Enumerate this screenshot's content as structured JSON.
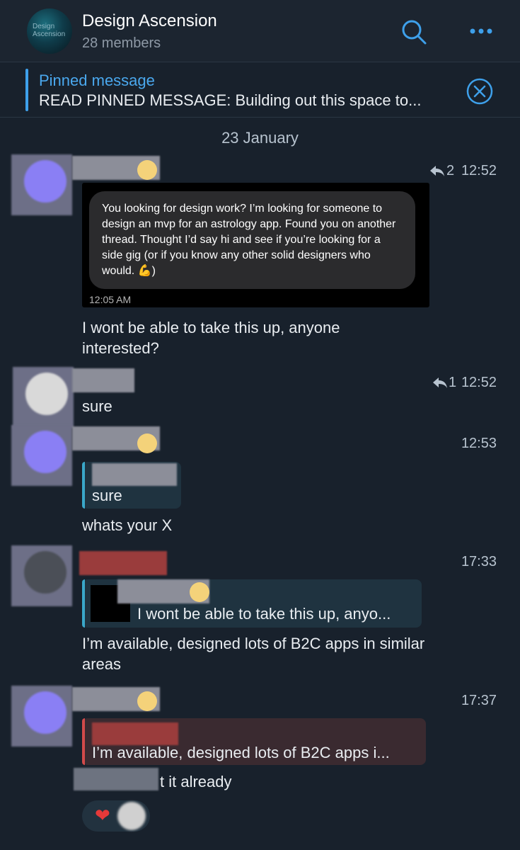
{
  "header": {
    "group_avatar_text_line1": "Design",
    "group_avatar_text_line2": "Ascension",
    "title": "Design Ascension",
    "subtitle": "28 members",
    "search_icon": "search-icon",
    "more_icon": "more-horizontal-icon"
  },
  "pinned": {
    "title": "Pinned message",
    "text": "READ PINNED MESSAGE:  Building out this space to...",
    "close_icon": "close-circle-icon"
  },
  "date_separator": "23 January",
  "messages": [
    {
      "reply_count": "2",
      "time": "12:52",
      "screenshot": {
        "bubble_text": "You looking for design work?  I’m looking for someone to design an mvp for an astrology app.  Found you on another thread.   Thought I’d say hi and see if you’re looking for a side gig (or if you know any other solid designers who would. 💪)",
        "time": "12:05 AM"
      },
      "text": "I wont be able to take this up, anyone interested?"
    },
    {
      "reply_count": "1",
      "time": "12:52",
      "text": "sure"
    },
    {
      "time": "12:53",
      "quote_text": "sure",
      "text": "whats your X"
    },
    {
      "time": "17:33",
      "quote_text": "I wont be able to take this up, anyo...",
      "text": "I’m available, designed lots of B2C apps in similar areas"
    },
    {
      "time": "17:37",
      "quote_text": "I’m available, designed lots of B2C apps i...",
      "text": "t it already"
    }
  ],
  "reaction": {
    "emoji": "❤"
  },
  "colors": {
    "background": "#18212c",
    "accent": "#3ea0ea",
    "text": "#e9edf1",
    "muted": "#b7c3cf"
  }
}
